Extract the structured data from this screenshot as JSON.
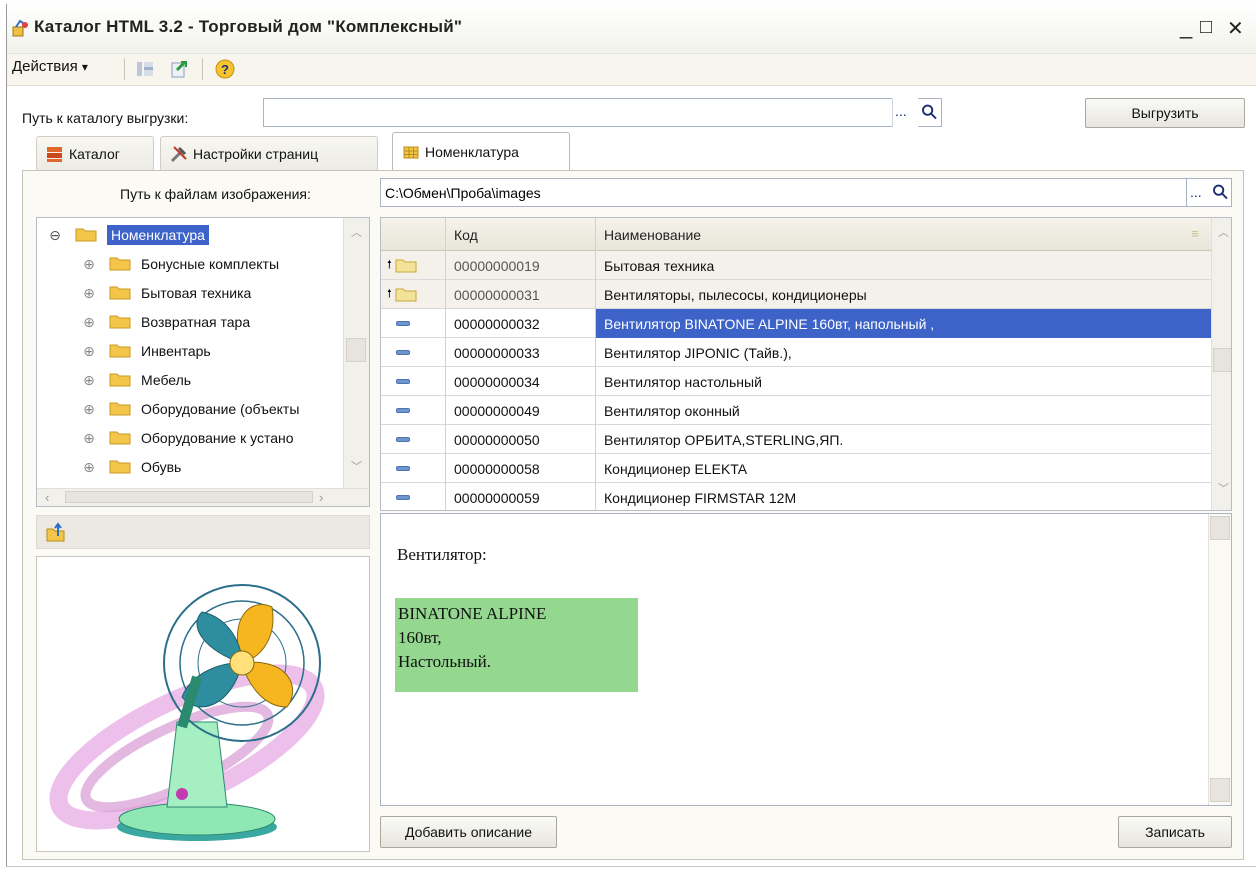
{
  "window": {
    "title": "Каталог HTML 3.2 - Торговый дом \"Комплексный\"",
    "minimize": "_",
    "maximize": "□",
    "close": "✕"
  },
  "menu": {
    "actions_label": "Действия",
    "actions_arrow": "▾",
    "toolbar_icons": [
      "grid-icon",
      "export-icon",
      "help-icon"
    ]
  },
  "export_path": {
    "label": "Путь к каталогу выгрузки:",
    "value": "",
    "browse": "...",
    "export_button": "Выгрузить"
  },
  "tabs": [
    {
      "label": "Каталог",
      "icon": "catalog-icon"
    },
    {
      "label": "Настройки страниц",
      "icon": "tools-icon"
    },
    {
      "label": "Номенклатура",
      "icon": "table-icon"
    }
  ],
  "image_path": {
    "label": "Путь к файлам изображения:",
    "value": "C:\\Обмен\\Проба\\images",
    "browse": "..."
  },
  "tree": {
    "root": "Номенклатура",
    "root_expander": "⊖",
    "items": [
      "Бонусные комплекты",
      "Бытовая техника",
      "Возвратная тара",
      "Инвентарь",
      "Мебель",
      "Оборудование (объекты",
      "Оборудование к устано",
      "Обувь"
    ],
    "item_expander": "⊕"
  },
  "grid": {
    "columns": [
      "Код",
      "Наименование"
    ],
    "rows": [
      {
        "kind": "group",
        "code": "00000000019",
        "name": "Бытовая техника"
      },
      {
        "kind": "group",
        "code": "00000000031",
        "name": "Вентиляторы, пылесосы, кондиционеры"
      },
      {
        "kind": "item",
        "code": "00000000032",
        "name": "Вентилятор BINATONE ALPINE 160вт, напольный ,",
        "selected": true
      },
      {
        "kind": "item",
        "code": "00000000033",
        "name": "Вентилятор JIPONIC (Тайв.),"
      },
      {
        "kind": "item",
        "code": "00000000034",
        "name": "Вентилятор настольный"
      },
      {
        "kind": "item",
        "code": "00000000049",
        "name": "Вентилятор оконный"
      },
      {
        "kind": "item",
        "code": "00000000050",
        "name": "Вентилятор ОРБИТА,STERLING,ЯП."
      },
      {
        "kind": "item",
        "code": "00000000058",
        "name": "Кондиционер ELEKTA"
      },
      {
        "kind": "item",
        "code": "00000000059",
        "name": "Кондиционер FIRMSTAR 12M"
      }
    ]
  },
  "description": {
    "title": "Вентилятор:",
    "lines": [
      "BINATONE ALPINE",
      "160вт,",
      "Настольный."
    ],
    "box_color": "#94d88f"
  },
  "buttons": {
    "add_description": "Добавить описание",
    "save": "Записать"
  },
  "colors": {
    "selection": "#3d63c9",
    "folder": "#f3c64a"
  }
}
